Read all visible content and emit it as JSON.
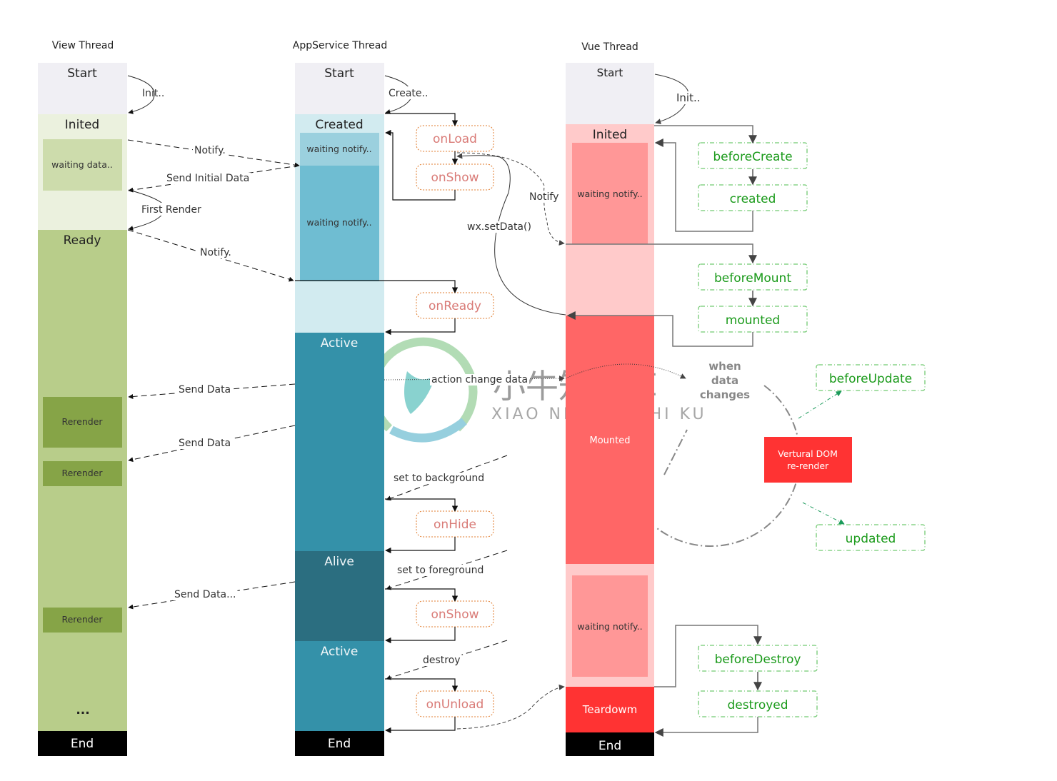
{
  "threads": {
    "view": {
      "title": "View Thread",
      "states": {
        "start": "Start",
        "inited": "Inited",
        "ready": "Ready",
        "end": "End",
        "ellipsis": "..."
      },
      "inner": {
        "waiting": "waiting data..",
        "rerender1": "Rerender",
        "rerender2": "Rerender",
        "rerender3": "Rerender"
      },
      "edges": {
        "init": "Init..",
        "first_render": "First Render"
      }
    },
    "appservice": {
      "title": "AppService Thread",
      "states": {
        "start": "Start",
        "created": "Created",
        "active1": "Active",
        "alive": "Alive",
        "active2": "Active",
        "end": "End"
      },
      "inner": {
        "waiting1": "waiting notify..",
        "waiting2": "waiting notify.."
      },
      "edges": {
        "create": "Create.."
      },
      "hooks": {
        "onLoad": "onLoad",
        "onShow1": "onShow",
        "onReady": "onReady",
        "onHide": "onHide",
        "onShow2": "onShow",
        "onUnload": "onUnload"
      }
    },
    "vue": {
      "title": "Vue Thread",
      "states": {
        "start": "Start",
        "inited": "Inited",
        "mounted": "Mounted",
        "teardown": "Teardowm",
        "end": "End"
      },
      "inner": {
        "waiting1": "waiting notify..",
        "waiting2": "waiting notify.."
      },
      "edges": {
        "init": "Init.."
      },
      "hooks": {
        "beforeCreate": "beforeCreate",
        "created": "created",
        "beforeMount": "beforeMount",
        "mounted": "mounted",
        "beforeUpdate": "beforeUpdate",
        "updated": "updated",
        "beforeDestroy": "beforeDestroy",
        "destroyed": "destroyed"
      },
      "update_cycle": {
        "when": "when",
        "data": "data",
        "changes": "changes",
        "vdom_line1": "Vertural DOM",
        "vdom_line2": "re-render"
      }
    }
  },
  "messages": {
    "notify1": "Notify.",
    "send_initial_data": "Send Initial Data",
    "notify2": "Notify.",
    "send_data1": "Send Data",
    "send_data2": "Send Data",
    "send_data3": "Send Data...",
    "notify_vue": "Notify",
    "set_data": "wx.setData()",
    "action_change_data": "action change data",
    "set_to_background": "set to background",
    "set_to_foreground": "set to foreground",
    "destroy": "destroy"
  },
  "watermark": {
    "cn": "小牛知识库",
    "en": "XIAO NIU ZHI SHI KU"
  },
  "colors": {
    "view_start": "#f0eff4",
    "view_inited": "#ebf1de",
    "view_inner": "#cddcac",
    "view_ready": "#b8cd8a",
    "view_rerender": "#86a447",
    "app_created": "#d2ebf0",
    "app_waiting1": "#9bd0de",
    "app_waiting2": "#6fbdd2",
    "app_active": "#3491a9",
    "app_alive": "#2b6e80",
    "vue_inited": "#ffcaca",
    "vue_inner": "#ff9797",
    "vue_mounted": "#ff6666",
    "vue_teardown": "#ff3333",
    "end": "#000000",
    "mp_hook_border": "#e07b2c",
    "vue_hook_border": "#72c972"
  }
}
